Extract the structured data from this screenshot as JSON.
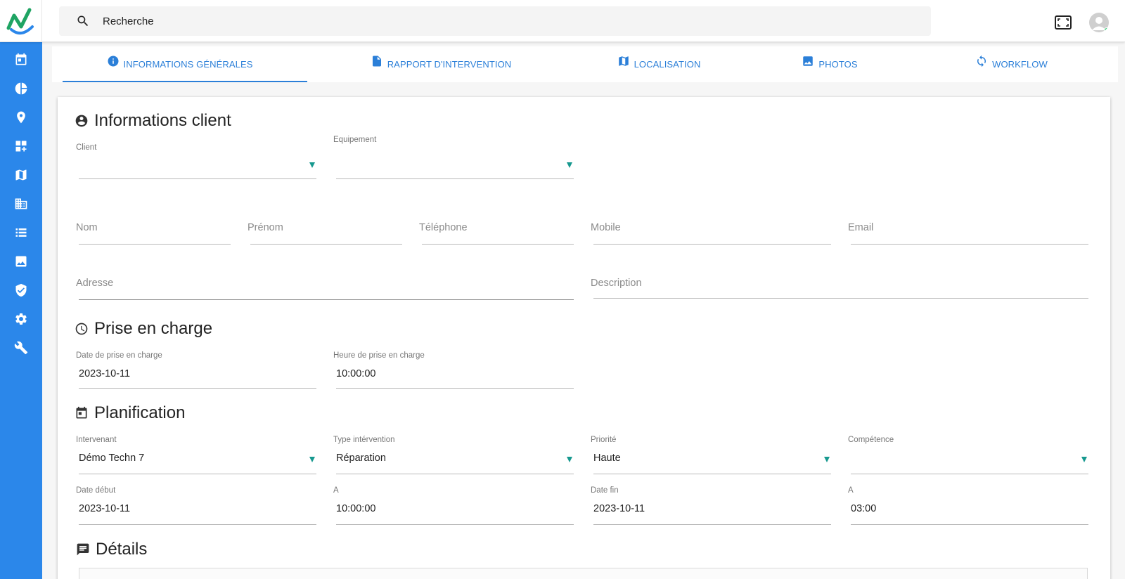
{
  "search": {
    "placeholder": "Recherche"
  },
  "sidebar": {
    "items": [
      {
        "name": "calendar-icon"
      },
      {
        "name": "pie-chart-icon"
      },
      {
        "name": "map-pin-icon"
      },
      {
        "name": "dashboard-icon"
      },
      {
        "name": "map-icon"
      },
      {
        "name": "building-icon"
      },
      {
        "name": "list-icon"
      },
      {
        "name": "image-icon"
      },
      {
        "name": "shield-check-icon"
      },
      {
        "name": "gear-icon"
      },
      {
        "name": "wrench-icon"
      }
    ]
  },
  "tabs": [
    {
      "label": "INFORMATIONS GÉNÉRALES",
      "icon": "info-icon",
      "active": true
    },
    {
      "label": "RAPPORT D'INTERVENTION",
      "icon": "document-icon"
    },
    {
      "label": "LOCALISATION",
      "icon": "map-icon"
    },
    {
      "label": "PHOTOS",
      "icon": "image-icon"
    },
    {
      "label": "WORKFLOW",
      "icon": "sync-icon"
    }
  ],
  "client_section": {
    "title": "Informations client",
    "client_label": "Client",
    "equipement_label": "Equipement",
    "nom_placeholder": "Nom",
    "prenom_placeholder": "Prénom",
    "telephone_placeholder": "Téléphone",
    "mobile_placeholder": "Mobile",
    "email_placeholder": "Email",
    "adresse_placeholder": "Adresse",
    "description_placeholder": "Description"
  },
  "prise_section": {
    "title": "Prise en charge",
    "date_label": "Date de prise en charge",
    "date_value": "2023-10-11",
    "heure_label": "Heure de prise en charge",
    "heure_value": "10:00:00"
  },
  "planif_section": {
    "title": "Planification",
    "intervenant_label": "Intervenant",
    "intervenant_value": "Démo Techn 7",
    "type_label": "Type intérvention",
    "type_value": "Réparation",
    "priorite_label": "Priorité",
    "priorite_value": "Haute",
    "competence_label": "Compétence",
    "competence_value": "",
    "date_debut_label": "Date début",
    "date_debut_value": "2023-10-11",
    "a1_label": "A",
    "a1_value": "10:00:00",
    "date_fin_label": "Date fin",
    "date_fin_value": "2023-10-11",
    "a2_label": "A",
    "a2_value": "03:00"
  },
  "details_section": {
    "title": "Détails"
  },
  "colors": {
    "sidebar": "#2b87ea",
    "accent": "#2b7fd8",
    "dropdown_arrow": "#17998f",
    "status_online": "#2ecc71"
  }
}
